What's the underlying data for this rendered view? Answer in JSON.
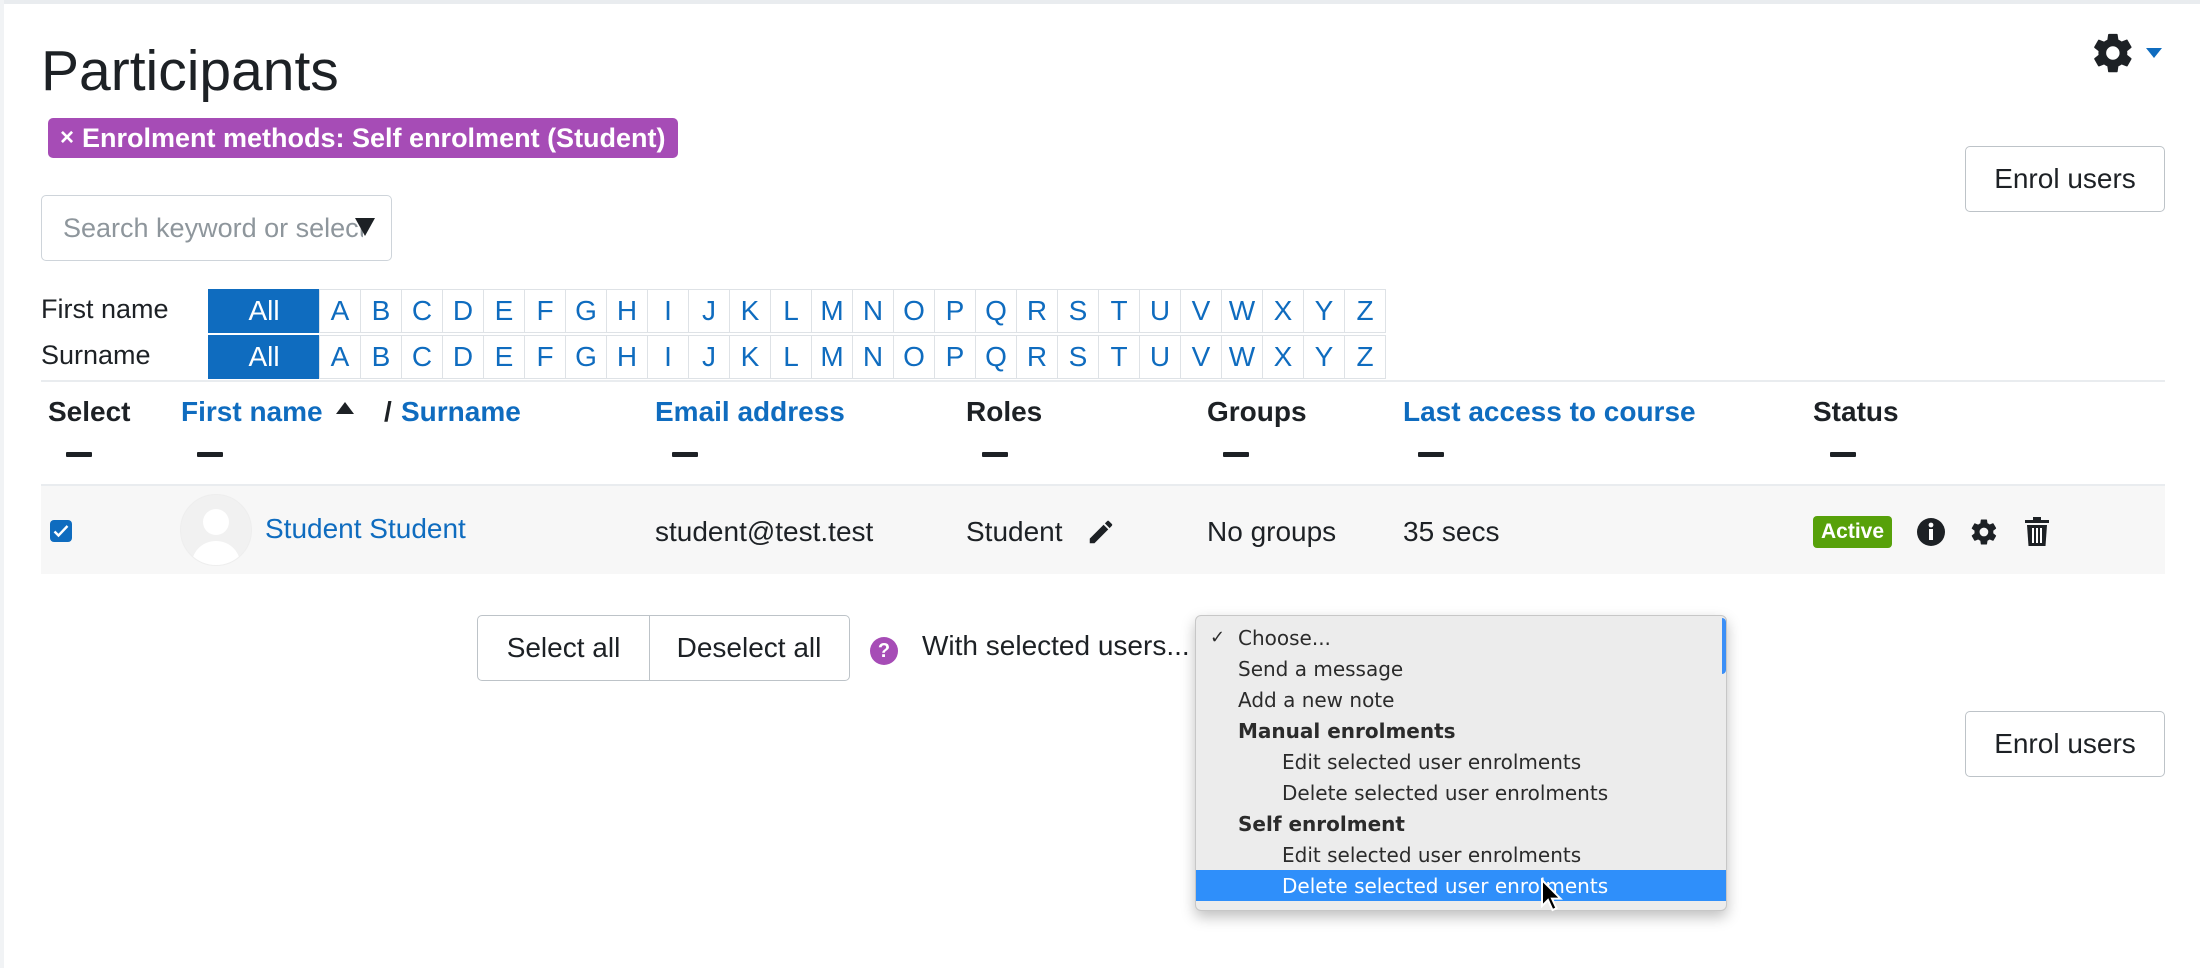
{
  "page": {
    "title": "Participants",
    "filter_badge": {
      "close": "×",
      "label": "Enrolment methods: Self enrolment (Student)"
    },
    "enrol_button": "Enrol users",
    "search": {
      "placeholder": "Search keyword or select filter"
    }
  },
  "initials": {
    "first_name_label": "First name",
    "surname_label": "Surname",
    "all_label": "All",
    "letters": [
      "A",
      "B",
      "C",
      "D",
      "E",
      "F",
      "G",
      "H",
      "I",
      "J",
      "K",
      "L",
      "M",
      "N",
      "O",
      "P",
      "Q",
      "R",
      "S",
      "T",
      "U",
      "V",
      "W",
      "X",
      "Y",
      "Z"
    ]
  },
  "table": {
    "headers": {
      "select": "Select",
      "first_name": "First name",
      "separator": "/",
      "surname": "Surname",
      "email": "Email address",
      "roles": "Roles",
      "groups": "Groups",
      "last_access": "Last access to course",
      "status": "Status"
    },
    "rows": [
      {
        "selected": true,
        "name": "Student Student",
        "email": "student@test.test",
        "role": "Student",
        "groups": "No groups",
        "last_access": "35 secs",
        "status": "Active"
      }
    ]
  },
  "bulk": {
    "select_all": "Select all",
    "deselect_all": "Deselect all",
    "help": "?",
    "with_selected_label": "With selected users...",
    "dropdown": {
      "options": [
        {
          "label": "Choose...",
          "level": 1,
          "checked": true
        },
        {
          "label": "Send a message",
          "level": 1
        },
        {
          "label": "Add a new note",
          "level": 1
        },
        {
          "label": "Manual enrolments",
          "level": 1,
          "group": true
        },
        {
          "label": "Edit selected user enrolments",
          "level": 2
        },
        {
          "label": "Delete selected user enrolments",
          "level": 2
        },
        {
          "label": "Self enrolment",
          "level": 1,
          "group": true
        },
        {
          "label": "Edit selected user enrolments",
          "level": 2
        },
        {
          "label": "Delete selected user enrolments",
          "level": 2,
          "highlighted": true
        }
      ]
    }
  },
  "colors": {
    "brand_blue": "#0f6cbf",
    "badge_purple": "#a64cb6",
    "active_green": "#57a10a",
    "highlight_blue": "#2f8ffa"
  },
  "icons": [
    "gear-icon",
    "caret-down-icon",
    "sort-asc-icon",
    "pencil-icon",
    "info-icon",
    "cog-icon",
    "trash-icon",
    "check-icon",
    "user-avatar-icon",
    "mouse-pointer-icon"
  ]
}
